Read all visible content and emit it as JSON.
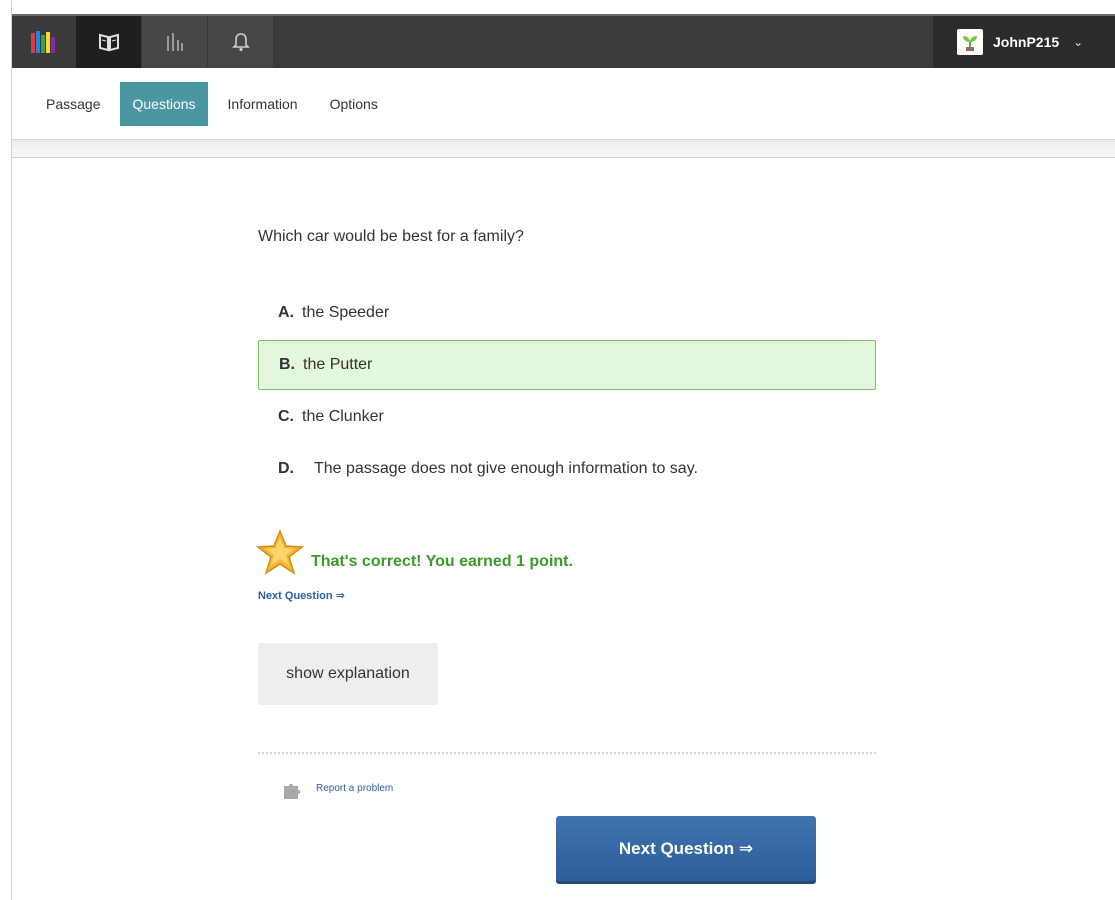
{
  "topbar": {
    "icons": [
      "bookshelf-logo-icon",
      "book-icon",
      "stats-icon",
      "bell-icon"
    ],
    "user": {
      "name": "JohnP215",
      "avatar_icon": "plant-avatar-icon",
      "dropdown_icon": "chevron-down-icon",
      "chevron": "⌄"
    }
  },
  "tabs": {
    "items": [
      {
        "label": "Passage"
      },
      {
        "label": "Questions"
      },
      {
        "label": "Information"
      },
      {
        "label": "Options"
      }
    ],
    "active": "Questions",
    "active_color": "#4a97a3"
  },
  "question": {
    "text": "Which car would be best for a family?",
    "options": [
      {
        "letter": "A.",
        "text": "the Speeder"
      },
      {
        "letter": "B.",
        "text": "the Putter"
      },
      {
        "letter": "C.",
        "text": "the Clunker"
      },
      {
        "letter": "D.",
        "text": "The passage does not give enough information to say."
      }
    ],
    "selected": "B.",
    "selected_bg": "#e3f7dc"
  },
  "feedback": {
    "icon": "star-icon",
    "message": "That's correct! You earned 1 point.",
    "next_link": "Next Question ⇒",
    "color": "#3c9a2a"
  },
  "actions": {
    "show_explanation": "show explanation",
    "report_icon": "puzzle-icon",
    "report_problem": "Report a problem",
    "next_button": "Next Question ⇒",
    "next_button_color": "#2c5d98"
  }
}
